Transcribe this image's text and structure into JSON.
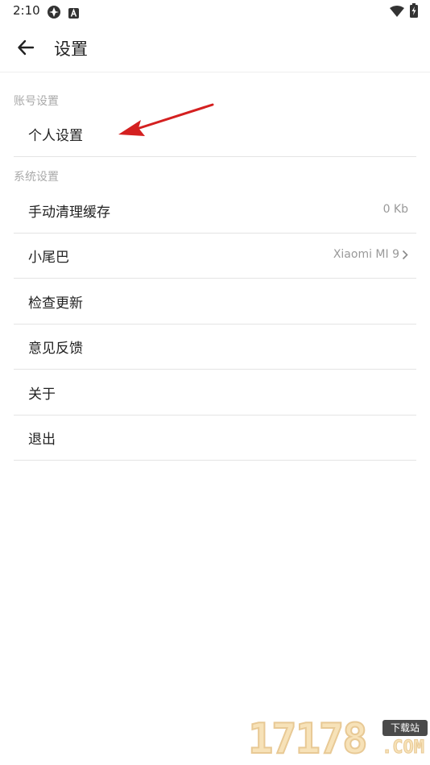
{
  "status_bar": {
    "time": "2:10",
    "icons": [
      "app-notification-icon",
      "a-letter-icon",
      "wifi-icon",
      "battery-charging-icon"
    ]
  },
  "app_bar": {
    "back_icon": "arrow-left-icon",
    "title": "设置"
  },
  "sections": [
    {
      "header": "账号设置",
      "items": [
        {
          "label": "个人设置",
          "value": ""
        }
      ]
    },
    {
      "header": "系统设置",
      "items": [
        {
          "label": "手动清理缓存",
          "value": "0 Kb"
        },
        {
          "label": "小尾巴",
          "value": "Xiaomi MI 9",
          "chevron": "chevron-right-icon"
        },
        {
          "label": "检查更新",
          "value": ""
        },
        {
          "label": "意见反馈",
          "value": ""
        },
        {
          "label": "关于",
          "value": ""
        },
        {
          "label": "退出",
          "value": ""
        }
      ]
    }
  ],
  "overlay": {
    "annotation_arrow_color": "#d42020"
  },
  "watermark": {
    "number": "17178",
    "badge": "下载站",
    "domain": ".COM"
  },
  "colors": {
    "section_header": "#aaaaaa",
    "divider": "#e4e4e4",
    "value_text": "#999999"
  }
}
